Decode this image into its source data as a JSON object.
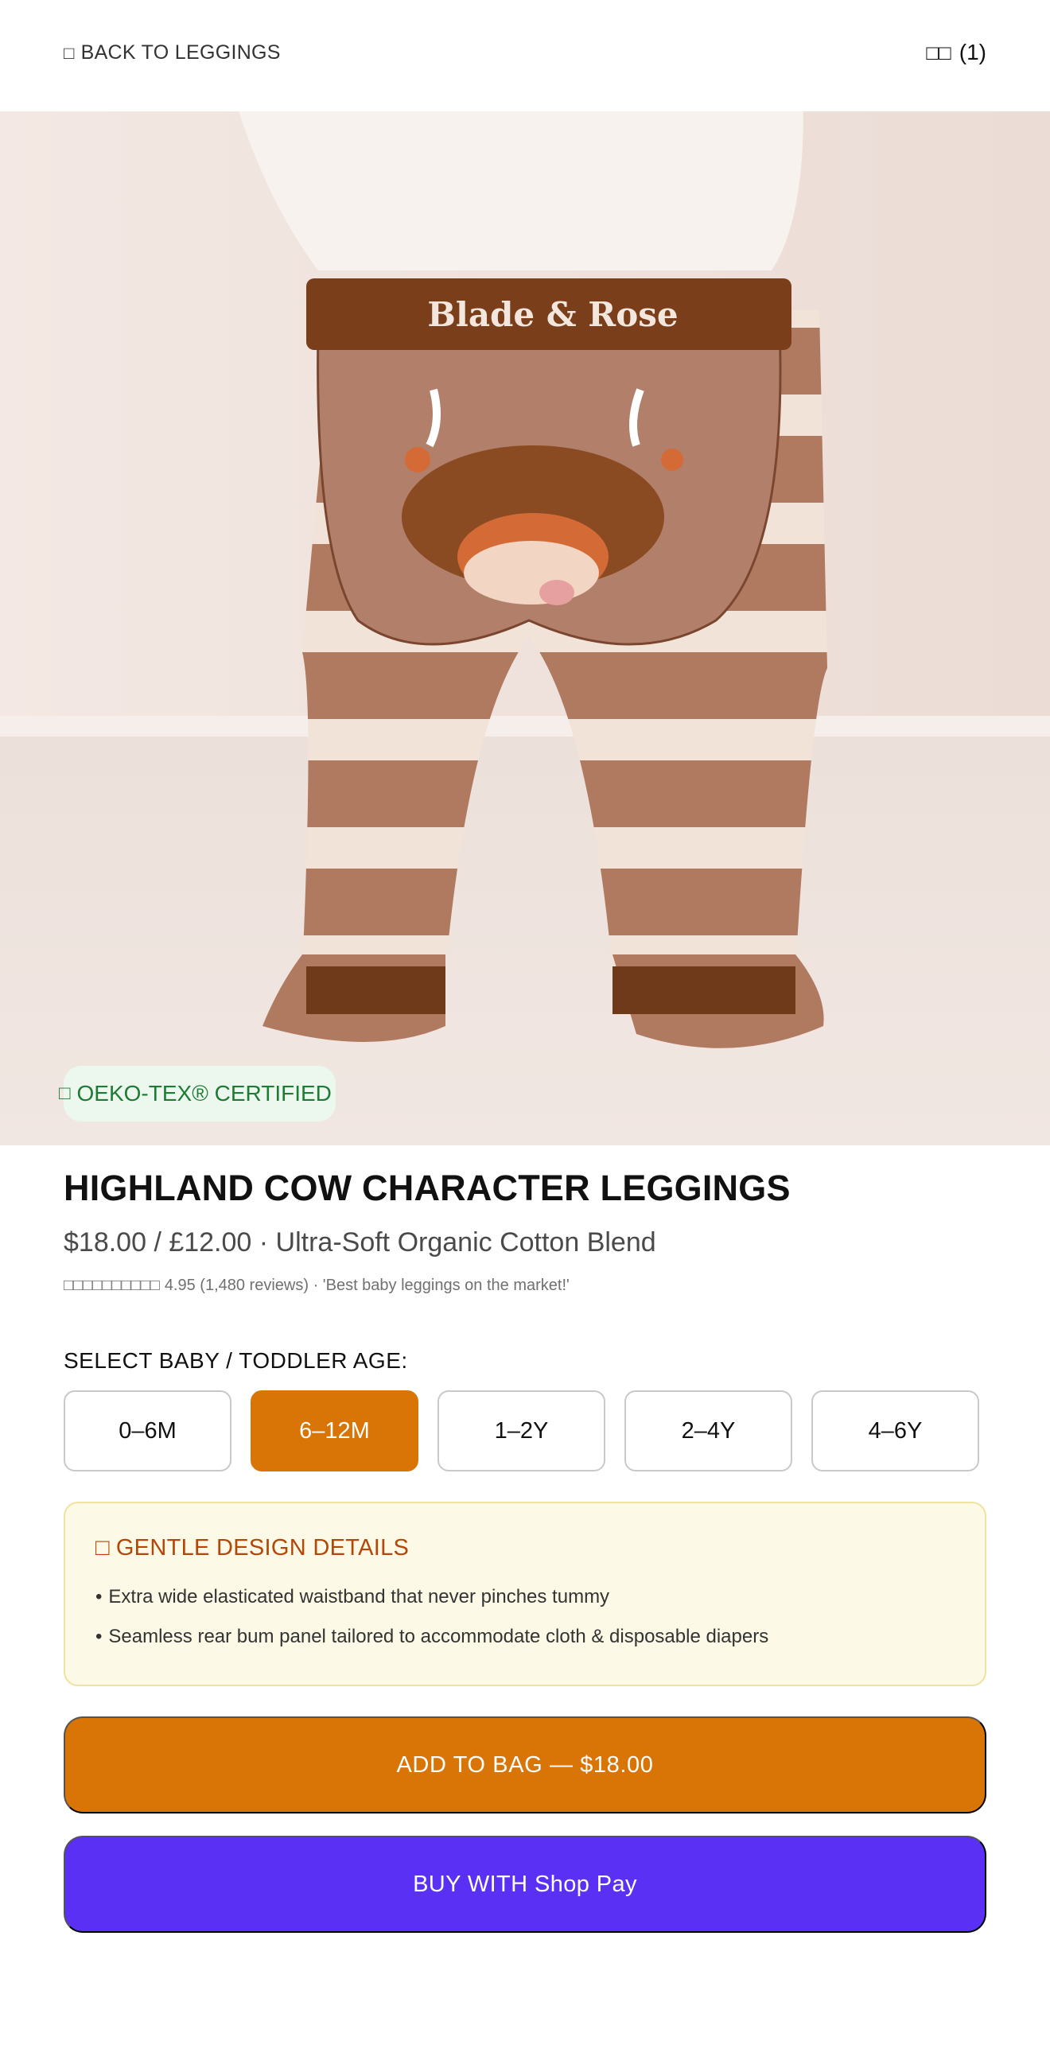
{
  "nav": {
    "back_icon": "□",
    "back_label": "BACK TO LEGGINGS",
    "bag_icon": "□□",
    "bag_count": "(1)"
  },
  "hero": {
    "image_desc_icon": "product-photo",
    "waistband_text": "Blade & Rose",
    "badge_icon": "□",
    "badge_label": "OEKO-TEX® CERTIFIED"
  },
  "product": {
    "title": "HIGHLAND COW CHARACTER LEGGINGS",
    "price_line": "$18.00 / £12.00 · Ultra-Soft Organic Cotton Blend",
    "rating_stars": "□□□□□□□□□□",
    "rating_text": "4.95 (1,480 reviews) · 'Best baby leggings on the market!'"
  },
  "age_selector": {
    "label": "SELECT BABY / TODDLER AGE:",
    "options": [
      "0–6M",
      "6–12M",
      "1–2Y",
      "2–4Y",
      "4–6Y"
    ],
    "selected": "6–12M"
  },
  "details": {
    "icon": "□",
    "title": "GENTLE DESIGN DETAILS",
    "bullet": "•",
    "items": [
      "Extra wide elasticated waistband that never pinches tummy",
      "Seamless rear bum panel tailored to accommodate cloth & disposable diapers"
    ]
  },
  "actions": {
    "add_to_bag": "ADD TO BAG — $18.00",
    "buy_with": "BUY WITH Shop Pay"
  },
  "colors": {
    "accent": "#d97506",
    "shop_pay": "#5a31f4",
    "details_title": "#b3470a",
    "badge_text": "#1f7a36"
  }
}
